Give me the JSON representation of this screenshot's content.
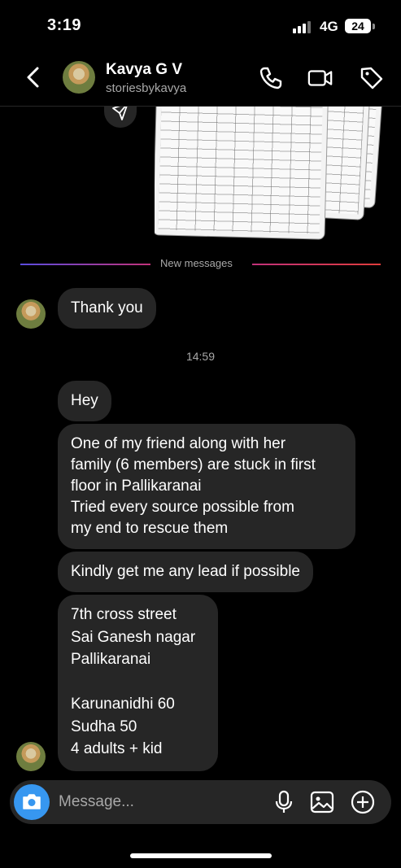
{
  "status_bar": {
    "time": "3:19",
    "network": "4G",
    "battery": "24"
  },
  "header": {
    "name": "Kavya G V",
    "username": "storiesbykavya"
  },
  "divider": {
    "label": "New messages"
  },
  "messages": [
    {
      "text": [
        "Thank you"
      ]
    },
    {
      "text": [
        "Hey"
      ]
    },
    {
      "text": [
        "One of my friend along with her",
        "family (6 members) are stuck in first",
        "floor in Pallikaranai",
        "Tried every source possible from",
        "my end to rescue them"
      ]
    },
    {
      "text": [
        "Kindly get me any lead if possible"
      ]
    },
    {
      "text": [
        "7th cross street",
        "Sai Ganesh nagar",
        "Pallikaranai",
        "",
        "Karunanidhi 60",
        "Sudha 50",
        "4 adults + kid"
      ]
    }
  ],
  "timestamp": "14:59",
  "composer": {
    "placeholder": "Message..."
  },
  "colors": {
    "accent": "#3797f0",
    "bubble": "#262626",
    "background": "#000000"
  }
}
